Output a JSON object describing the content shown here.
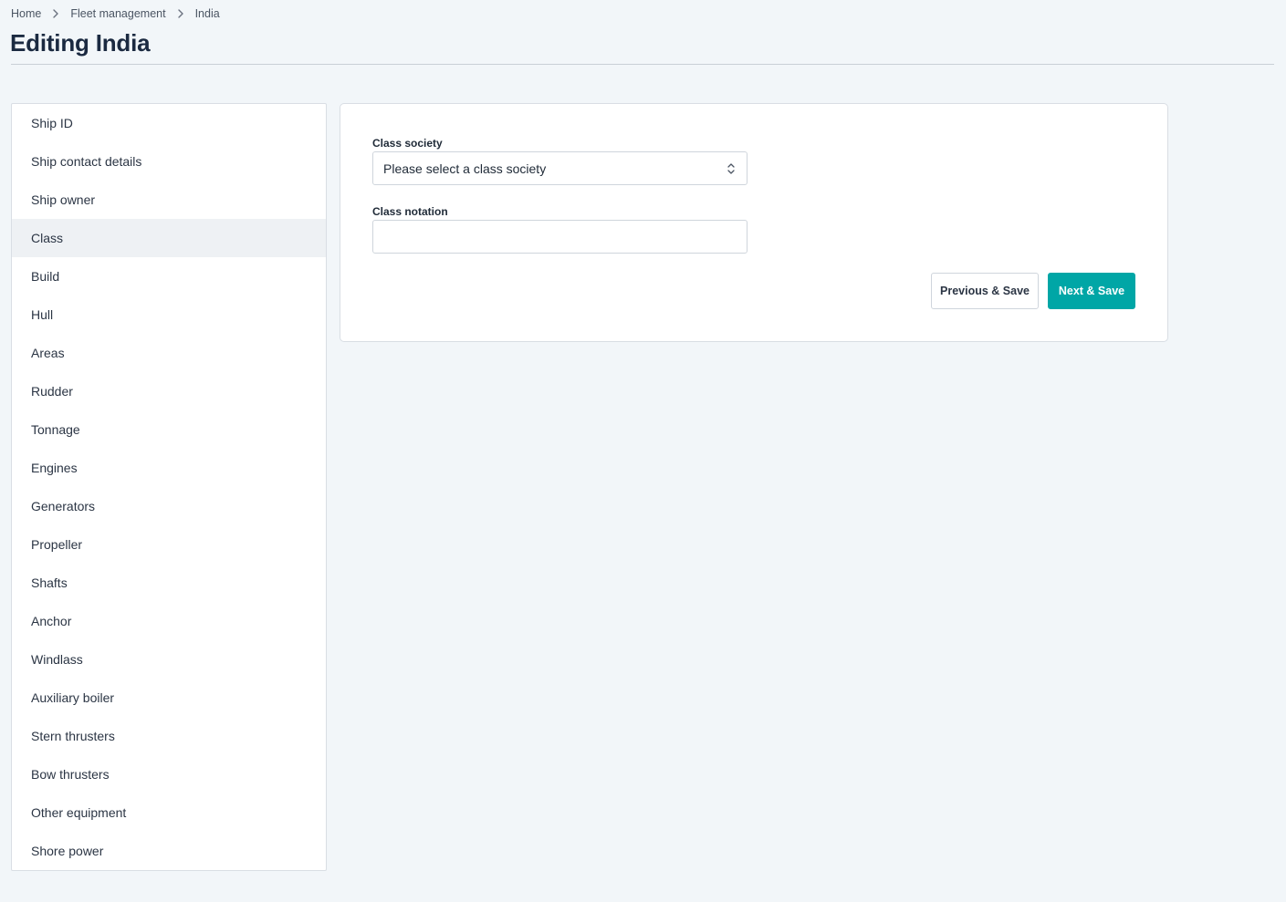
{
  "breadcrumb": {
    "items": [
      "Home",
      "Fleet management",
      "India"
    ]
  },
  "page": {
    "title": "Editing India"
  },
  "sidebar": {
    "active_index": 3,
    "items": [
      {
        "label": "Ship ID"
      },
      {
        "label": "Ship contact details"
      },
      {
        "label": "Ship owner"
      },
      {
        "label": "Class"
      },
      {
        "label": "Build"
      },
      {
        "label": "Hull"
      },
      {
        "label": "Areas"
      },
      {
        "label": "Rudder"
      },
      {
        "label": "Tonnage"
      },
      {
        "label": "Engines"
      },
      {
        "label": "Generators"
      },
      {
        "label": "Propeller"
      },
      {
        "label": "Shafts"
      },
      {
        "label": "Anchor"
      },
      {
        "label": "Windlass"
      },
      {
        "label": "Auxiliary boiler"
      },
      {
        "label": "Stern thrusters"
      },
      {
        "label": "Bow thrusters"
      },
      {
        "label": "Other equipment"
      },
      {
        "label": "Shore power"
      }
    ]
  },
  "form": {
    "class_society": {
      "label": "Class society",
      "placeholder": "Please select a class society",
      "value": ""
    },
    "class_notation": {
      "label": "Class notation",
      "value": ""
    },
    "previous_label": "Previous & Save",
    "next_label": "Next & Save"
  },
  "icons": {
    "breadcrumb_separator": "chevron-right-icon",
    "select_indicator": "chevron-up-down-icon"
  },
  "colors": {
    "background": "#f2f6f9",
    "primary": "#00a6a6",
    "active_item": "#eef1f4",
    "title": "#1b2a41"
  }
}
